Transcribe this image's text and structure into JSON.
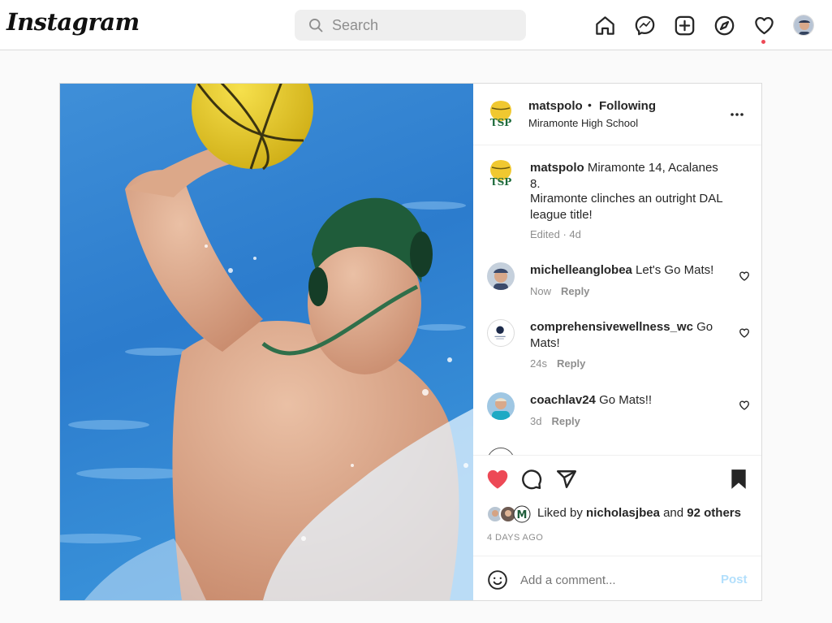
{
  "app": {
    "logo_text": "Instagram"
  },
  "search": {
    "placeholder": "Search"
  },
  "nav_icons": [
    "home-icon",
    "messenger-icon",
    "new-post-icon",
    "explore-icon",
    "activity-heart-icon",
    "profile-avatar"
  ],
  "colors": {
    "like_red": "#ed4956",
    "link_blue": "#0095f6",
    "post_disabled": "#b2dffc"
  },
  "post": {
    "username": "matspolo",
    "separator": "•",
    "follow_status": "Following",
    "location": "Miramonte High School",
    "caption_user": "matspolo",
    "caption_line1": "Miramonte 14, Acalanes 8.",
    "caption_line2": "Miramonte clinches an outright DAL league title!",
    "caption_meta": "Edited · 4d",
    "comments": [
      {
        "user": "michelleanglobea",
        "text": "Let's Go Mats!",
        "time": "Now",
        "reply": "Reply"
      },
      {
        "user": "comprehensivewellness_wc",
        "text": "Go Mats!",
        "time": "24s",
        "reply": "Reply"
      },
      {
        "user": "coachlav24",
        "text": "Go Mats!!",
        "time": "3d",
        "reply": "Reply"
      }
    ],
    "liked_prefix": "Liked by",
    "liked_user": "nicholasjbea",
    "liked_and": "and",
    "liked_others": "92 others",
    "date": "4 DAYS AGO",
    "comment_placeholder": "Add a comment...",
    "post_button": "Post"
  }
}
